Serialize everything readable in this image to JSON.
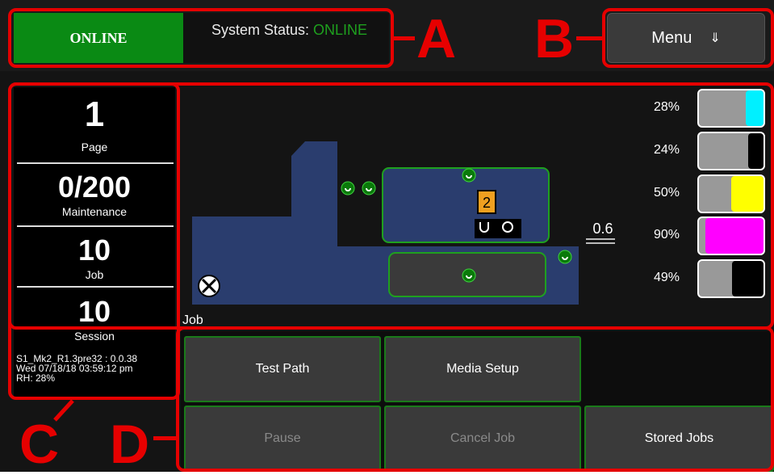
{
  "header": {
    "badge_label": "ONLINE",
    "status_prefix": "System Status: ",
    "status_value": "ONLINE",
    "menu_label": "Menu",
    "menu_icon": "double-arrow-down-icon",
    "menu_arrow": "⇓"
  },
  "callouts": {
    "a": "A",
    "b": "B",
    "c": "C",
    "d": "D"
  },
  "stats": [
    {
      "value": "1",
      "label": "Page"
    },
    {
      "value": "0/200",
      "label": "Maintenance"
    },
    {
      "value": "10",
      "label": "Job"
    },
    {
      "value": "10",
      "label": "Session"
    }
  ],
  "version_info": "S1_Mk2_R1.3pre32 : 0.0.38\nWed 07/18/18 03:59:12 pm\nRH: 28%",
  "diagram": {
    "tray_number": "2",
    "thickness_value": "0.6",
    "job_label": "Job"
  },
  "ink_levels": [
    {
      "percent": "28%",
      "level": 0.28,
      "color": "#00f0ff"
    },
    {
      "percent": "24%",
      "level": 0.24,
      "color": "#000000"
    },
    {
      "percent": "50%",
      "level": 0.5,
      "color": "#ffff00"
    },
    {
      "percent": "90%",
      "level": 0.9,
      "color": "#ff00ff"
    },
    {
      "percent": "49%",
      "level": 0.49,
      "color": "#000000"
    }
  ],
  "buttons": {
    "test_path": "Test Path",
    "media_setup": "Media Setup",
    "pause": "Pause",
    "cancel_job": "Cancel Job",
    "stored_jobs": "Stored Jobs"
  },
  "colors": {
    "online_green": "#0a8a14",
    "annotation_red": "#e60000",
    "button_border_green": "#1a7a1a",
    "media_path_blue": "#2a3d6e"
  }
}
